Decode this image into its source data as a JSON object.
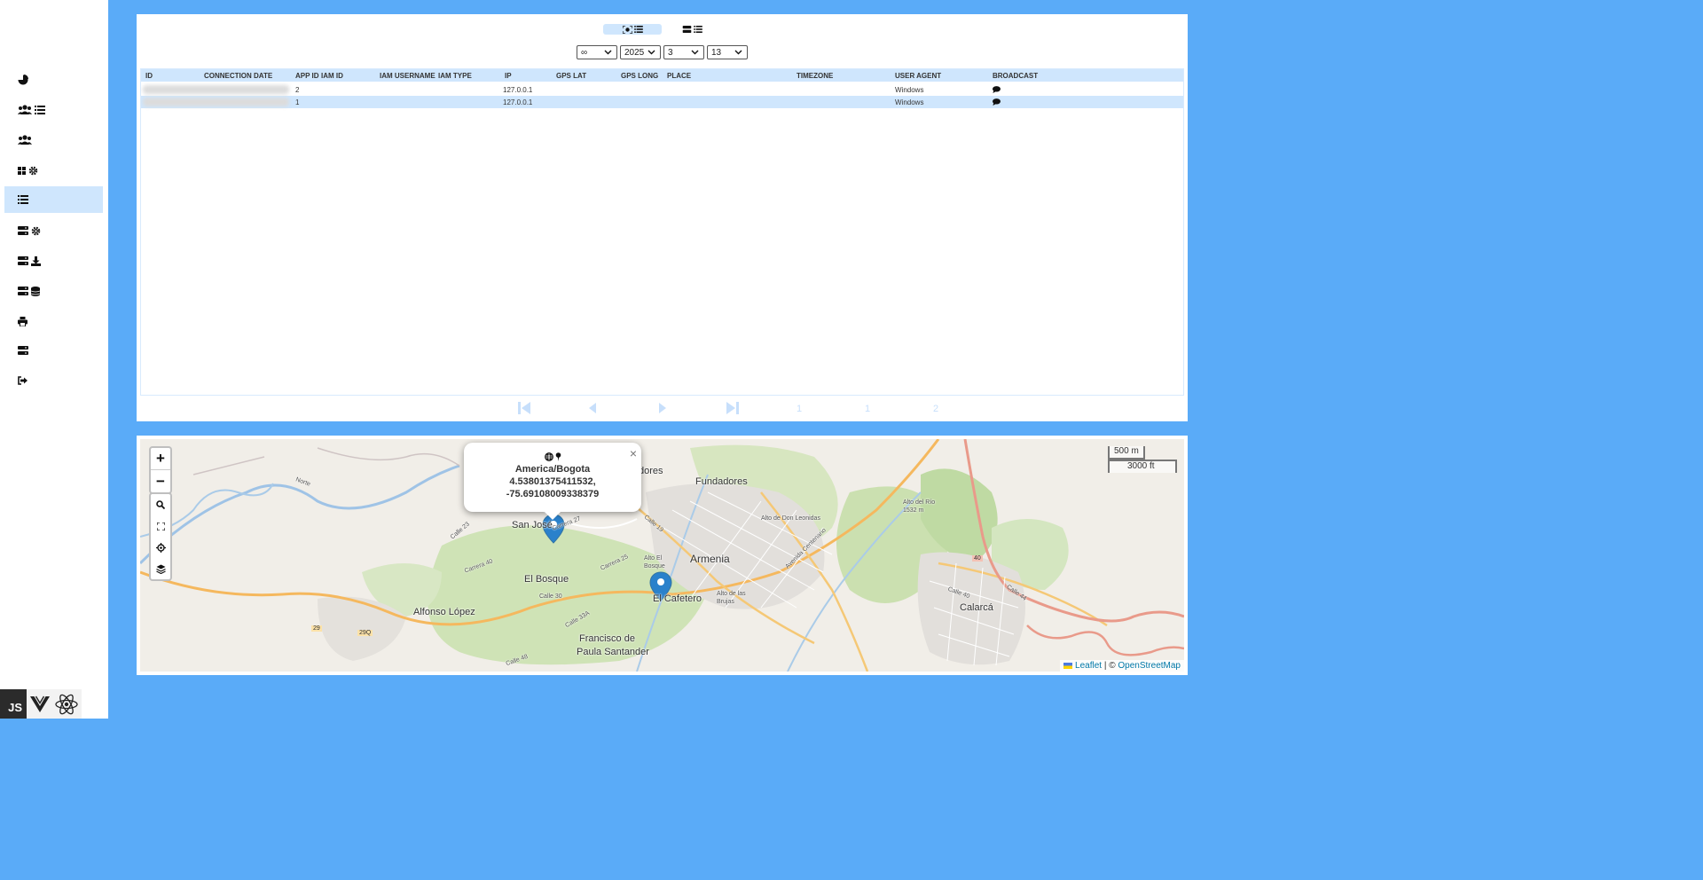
{
  "sidebar": {
    "items": [
      {
        "name": "nav-dashboard",
        "icon": "pie-chart-icon"
      },
      {
        "name": "nav-users-list",
        "icon": "users-list-icon"
      },
      {
        "name": "nav-users",
        "icon": "users-icon"
      },
      {
        "name": "nav-apps-settings",
        "icon": "grid-gear-icon"
      },
      {
        "name": "nav-connections-list",
        "icon": "list-icon",
        "active": true
      },
      {
        "name": "nav-server-settings",
        "icon": "server-gear-icon"
      },
      {
        "name": "nav-server-download",
        "icon": "server-download-icon"
      },
      {
        "name": "nav-server-database",
        "icon": "server-database-icon"
      },
      {
        "name": "nav-print",
        "icon": "print-icon"
      },
      {
        "name": "nav-server",
        "icon": "server-icon"
      },
      {
        "name": "nav-logout",
        "icon": "sign-out-icon"
      }
    ],
    "footer_logos": {
      "js": "JS"
    }
  },
  "filters": {
    "period": "∞",
    "year": "2025",
    "month": "3",
    "day": "13"
  },
  "table": {
    "columns": [
      "ID",
      "CONNECTION DATE",
      "APP ID",
      "IAM ID",
      "IAM USERNAME",
      "IAM TYPE",
      "IP",
      "GPS LAT",
      "GPS LONG",
      "PLACE",
      "TIMEZONE",
      "USER AGENT",
      "BROADCAST"
    ],
    "rows": [
      {
        "app_id": "2",
        "ip": "127.0.0.1",
        "user_agent": "Windows"
      },
      {
        "app_id": "1",
        "ip": "127.0.0.1",
        "user_agent": "Windows"
      }
    ]
  },
  "pagination": {
    "current": "1",
    "from": "1",
    "total": "2"
  },
  "map": {
    "popup": {
      "timezone": "America/Bogota",
      "lat": "4.53801375411532,",
      "long": "-75.69108009338379",
      "close": "×"
    },
    "zoom_in": "+",
    "zoom_out": "−",
    "scale_metric": "500 m",
    "scale_imperial": "3000 ft",
    "attribution_leaflet": "Leaflet",
    "attribution_sep": " | © ",
    "attribution_osm": "OpenStreetMap",
    "labels": {
      "armenia": "Armenia",
      "fundadores": "Fundadores",
      "el_bosque": "El Bosque",
      "alfonso_lopez": "Alfonso López",
      "calarca": "Calarcá",
      "francisco": "Francisco de",
      "paula": "Paula Santander",
      "encafetero": "El Cafetero",
      "san_jose": "San José",
      "dores": "dores",
      "alto_el_bosque": "Alto El Bosque",
      "alto_don": "Alto de Don Leonidas",
      "alto_rio": "Alto del Río 1532 m",
      "alto_brujas": "Alto de las Brujas",
      "avenida": "Avenida Centenario",
      "norte": "Norte",
      "calle23": "Calle 23",
      "carrera40": "Carrera 40",
      "carrera25": "Carrera 25",
      "carrera27": "Carrera 27",
      "calle19": "Calle 19",
      "calle30": "Calle 30",
      "calle33a": "Calle 33A",
      "calle48": "Calle 48",
      "calle44": "Calle 44",
      "calle40": "Calle 40",
      "r29": "29",
      "r29q": "29Q",
      "r40": "40"
    }
  },
  "colors": {
    "background": "#5aabf8",
    "accent_light": "#cfe6fd",
    "marker": "#2a81cb"
  }
}
